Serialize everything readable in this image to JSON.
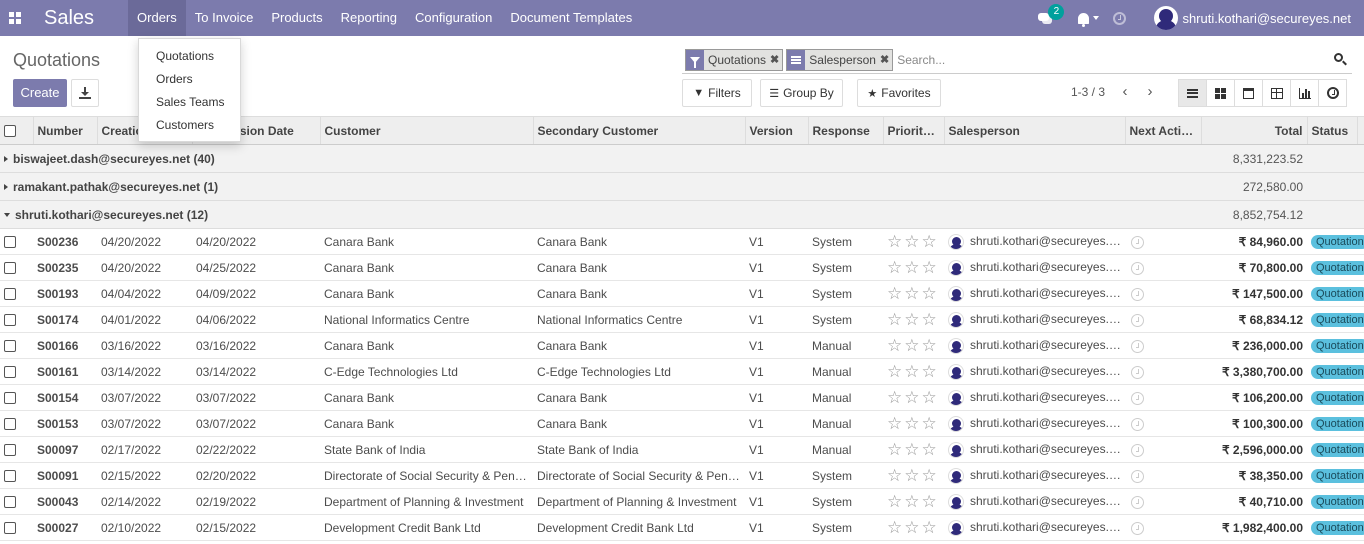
{
  "nav": {
    "brand": "Sales",
    "menus": [
      "Orders",
      "To Invoice",
      "Products",
      "Reporting",
      "Configuration",
      "Document Templates"
    ],
    "messages_count": "2",
    "user": "shruti.kothari@secureyes.net"
  },
  "orders_menu": {
    "items": [
      "Quotations",
      "Orders",
      "Sales Teams",
      "Customers"
    ]
  },
  "control": {
    "breadcrumb": "Quotations",
    "create_label": "Create",
    "facets": [
      {
        "icon": "filter-icon",
        "label": "Quotations"
      },
      {
        "icon": "group-by-icon",
        "label": "Salesperson"
      }
    ],
    "search_placeholder": "Search...",
    "filters_label": "Filters",
    "groupby_label": "Group By",
    "favorites_label": "Favorites",
    "pager": "1-3 / 3"
  },
  "table": {
    "headers": [
      "Number",
      "Creation Date",
      "Submission Date",
      "Customer",
      "Secondary Customer",
      "Version",
      "Response",
      "Priority…",
      "Salesperson",
      "Next Activity",
      "Total",
      "Status"
    ],
    "groups": [
      {
        "label": "biswajeet.dash@secureyes.net (40)",
        "total": "8,331,223.52",
        "expanded": false
      },
      {
        "label": "ramakant.pathak@secureyes.net (1)",
        "total": "272,580.00",
        "expanded": false
      },
      {
        "label": "shruti.kothari@secureyes.net (12)",
        "total": "8,852,754.12",
        "expanded": true
      }
    ],
    "rows": [
      {
        "number": "S00236",
        "creation": "04/20/2022",
        "submission": "04/20/2022",
        "customer": "Canara Bank",
        "secondary": "Canara Bank",
        "version": "V1",
        "response": "System",
        "salesperson": "shruti.kothari@secureyes.net",
        "total": "₹ 84,960.00",
        "status": "Quotation"
      },
      {
        "number": "S00235",
        "creation": "04/20/2022",
        "submission": "04/25/2022",
        "customer": "Canara Bank",
        "secondary": "Canara Bank",
        "version": "V1",
        "response": "System",
        "salesperson": "shruti.kothari@secureyes.net",
        "total": "₹ 70,800.00",
        "status": "Quotation"
      },
      {
        "number": "S00193",
        "creation": "04/04/2022",
        "submission": "04/09/2022",
        "customer": "Canara Bank",
        "secondary": "Canara Bank",
        "version": "V1",
        "response": "System",
        "salesperson": "shruti.kothari@secureyes.net",
        "total": "₹ 147,500.00",
        "status": "Quotation"
      },
      {
        "number": "S00174",
        "creation": "04/01/2022",
        "submission": "04/06/2022",
        "customer": "National Informatics Centre",
        "secondary": "National Informatics Centre",
        "version": "V1",
        "response": "System",
        "salesperson": "shruti.kothari@secureyes.net",
        "total": "₹ 68,834.12",
        "status": "Quotation"
      },
      {
        "number": "S00166",
        "creation": "03/16/2022",
        "submission": "03/16/2022",
        "customer": "Canara Bank",
        "secondary": "Canara Bank",
        "version": "V1",
        "response": "Manual",
        "salesperson": "shruti.kothari@secureyes.net",
        "total": "₹ 236,000.00",
        "status": "Quotation"
      },
      {
        "number": "S00161",
        "creation": "03/14/2022",
        "submission": "03/14/2022",
        "customer": "C-Edge Technologies Ltd",
        "secondary": "C-Edge Technologies Ltd",
        "version": "V1",
        "response": "Manual",
        "salesperson": "shruti.kothari@secureyes.net",
        "total": "₹ 3,380,700.00",
        "status": "Quotation"
      },
      {
        "number": "S00154",
        "creation": "03/07/2022",
        "submission": "03/07/2022",
        "customer": "Canara Bank",
        "secondary": "Canara Bank",
        "version": "V1",
        "response": "Manual",
        "salesperson": "shruti.kothari@secureyes.net",
        "total": "₹ 106,200.00",
        "status": "Quotation"
      },
      {
        "number": "S00153",
        "creation": "03/07/2022",
        "submission": "03/07/2022",
        "customer": "Canara Bank",
        "secondary": "Canara Bank",
        "version": "V1",
        "response": "Manual",
        "salesperson": "shruti.kothari@secureyes.net",
        "total": "₹ 100,300.00",
        "status": "Quotation"
      },
      {
        "number": "S00097",
        "creation": "02/17/2022",
        "submission": "02/22/2022",
        "customer": "State Bank of India",
        "secondary": "State Bank of India",
        "version": "V1",
        "response": "Manual",
        "salesperson": "shruti.kothari@secureyes.net",
        "total": "₹ 2,596,000.00",
        "status": "Quotation"
      },
      {
        "number": "S00091",
        "creation": "02/15/2022",
        "submission": "02/20/2022",
        "customer": "Directorate of Social Security & Pensions",
        "secondary": "Directorate of Social Security & Pensions",
        "version": "V1",
        "response": "System",
        "salesperson": "shruti.kothari@secureyes.net",
        "total": "₹ 38,350.00",
        "status": "Quotation"
      },
      {
        "number": "S00043",
        "creation": "02/14/2022",
        "submission": "02/19/2022",
        "customer": "Department of Planning & Investment",
        "secondary": "Department of Planning & Investment",
        "version": "V1",
        "response": "System",
        "salesperson": "shruti.kothari@secureyes.net",
        "total": "₹ 40,710.00",
        "status": "Quotation"
      },
      {
        "number": "S00027",
        "creation": "02/10/2022",
        "submission": "02/15/2022",
        "customer": "Development Credit Bank Ltd",
        "secondary": "Development Credit Bank Ltd",
        "version": "V1",
        "response": "System",
        "salesperson": "shruti.kothari@secureyes.net",
        "total": "₹ 1,982,400.00",
        "status": "Quotation"
      }
    ]
  }
}
